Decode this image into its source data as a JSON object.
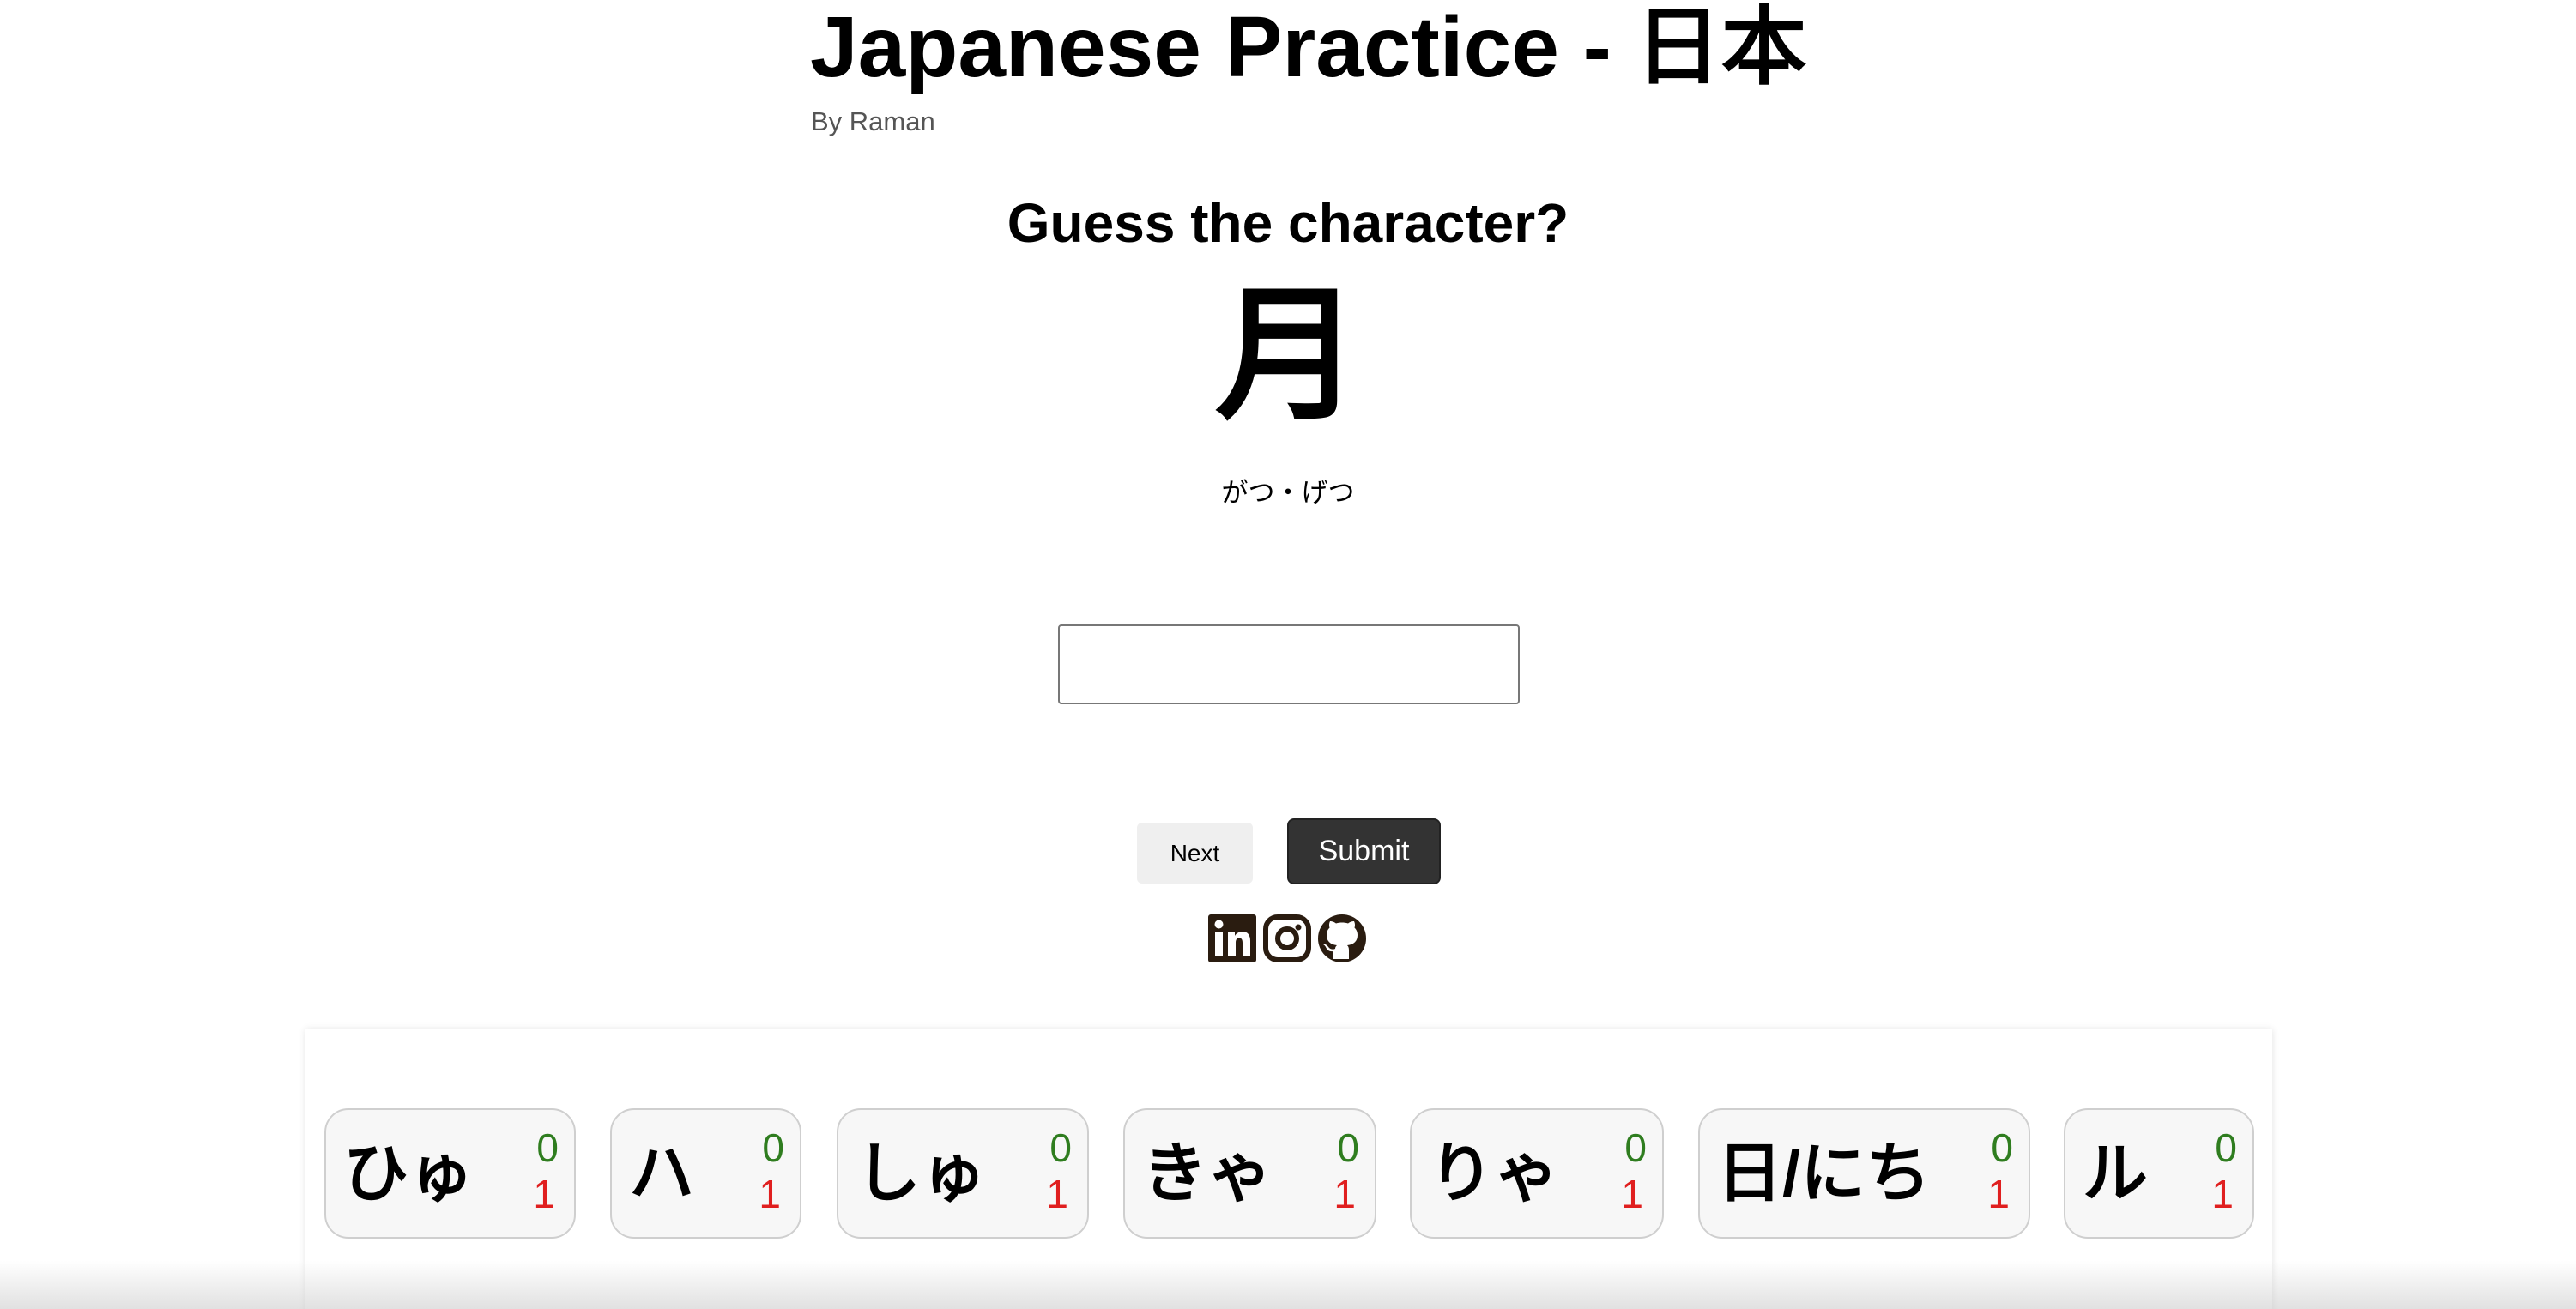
{
  "header": {
    "title": "Japanese Practice - 日本",
    "author": "By Raman"
  },
  "quiz": {
    "question": "Guess the character?",
    "character": "月",
    "reading": "がつ・げつ",
    "answer_value": "",
    "answer_placeholder": ""
  },
  "buttons": {
    "next_label": "Next",
    "submit_label": "Submit"
  },
  "social": {
    "icons": [
      "linkedin-icon",
      "instagram-icon",
      "github-icon"
    ],
    "color": "#2a1c10"
  },
  "stats": {
    "correct_color": "#2f7d1f",
    "wrong_color": "#e01f1f",
    "cards": [
      {
        "label": "ひゅ",
        "correct": "0",
        "wrong": "1"
      },
      {
        "label": "ハ",
        "correct": "0",
        "wrong": "1"
      },
      {
        "label": "しゅ",
        "correct": "0",
        "wrong": "1"
      },
      {
        "label": "きゃ",
        "correct": "0",
        "wrong": "1"
      },
      {
        "label": "りゃ",
        "correct": "0",
        "wrong": "1"
      },
      {
        "label": "日/にち",
        "correct": "0",
        "wrong": "1"
      },
      {
        "label": "ル",
        "correct": "0",
        "wrong": "1"
      }
    ]
  }
}
